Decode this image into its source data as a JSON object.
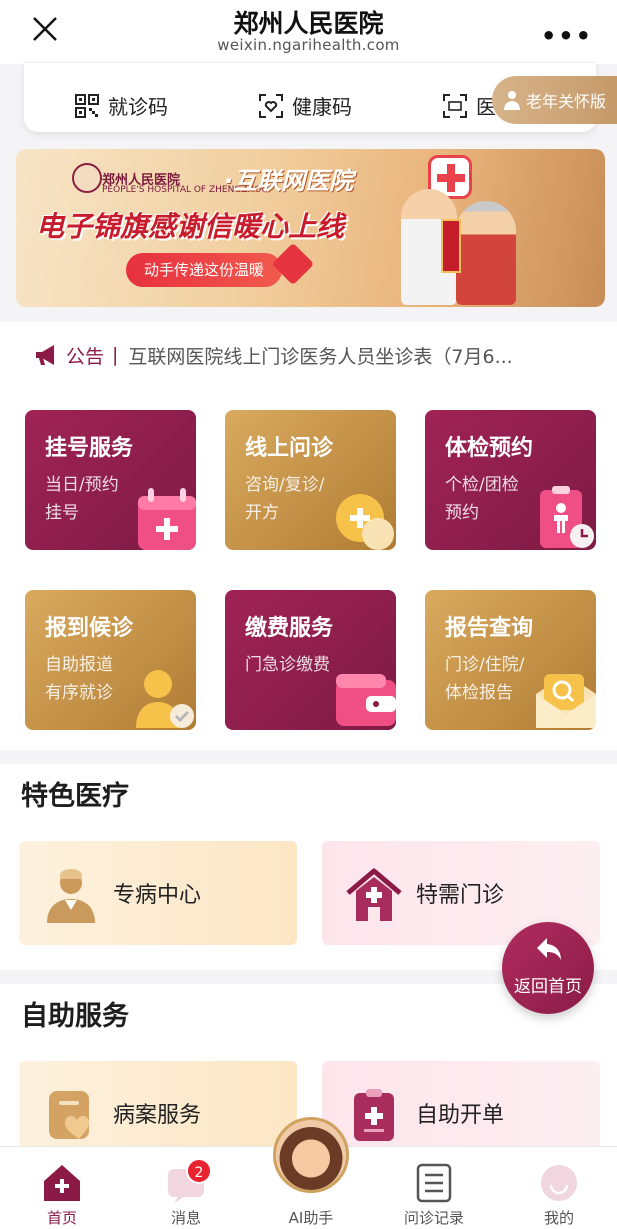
{
  "navbar": {
    "title": "郑州人民医院",
    "subtitle": "weixin.ngarihealth.com",
    "more": "•••"
  },
  "codes": {
    "visit_code": "就诊码",
    "health_code": "健康码",
    "insurance_code": "医",
    "elder_mode": "老年关怀版"
  },
  "banner": {
    "hospital_name": "郑州人民医院",
    "hospital_en": "PEOPLE'S HOSPITAL OF ZHENGZHOU",
    "internet_hospital": "·互联网医院",
    "headline": "电子锦旗感谢信暖心上线",
    "pill": "动手传递这份温暖"
  },
  "notice": {
    "label": "公告",
    "separator": "|",
    "text": "互联网医院线上门诊医务人员坐诊表（7月6..."
  },
  "services": [
    {
      "title": "挂号服务",
      "line1": "当日/预约",
      "line2": "挂号"
    },
    {
      "title": "线上问诊",
      "line1": "咨询/复诊/",
      "line2": "开方"
    },
    {
      "title": "体检预约",
      "line1": "个检/团检",
      "line2": "预约"
    },
    {
      "title": "报到候诊",
      "line1": "自助报道",
      "line2": "有序就诊"
    },
    {
      "title": "缴费服务",
      "line1": "门急诊缴费",
      "line2": ""
    },
    {
      "title": "报告查询",
      "line1": "门诊/住院/",
      "line2": "体检报告"
    }
  ],
  "featured": {
    "title": "特色医疗",
    "items": [
      {
        "label": "专病中心"
      },
      {
        "label": "特需门诊"
      }
    ]
  },
  "self_service": {
    "title": "自助服务",
    "items": [
      {
        "label": "病案服务"
      },
      {
        "label": "自助开单"
      }
    ]
  },
  "back_home": "返回首页",
  "tabbar": {
    "items": [
      {
        "label": "首页"
      },
      {
        "label": "消息"
      },
      {
        "label": "AI助手"
      },
      {
        "label": "问诊记录"
      },
      {
        "label": "我的"
      }
    ],
    "message_badge": "2"
  },
  "colors": {
    "primary": "#8b1b46",
    "gold": "#c79044"
  }
}
